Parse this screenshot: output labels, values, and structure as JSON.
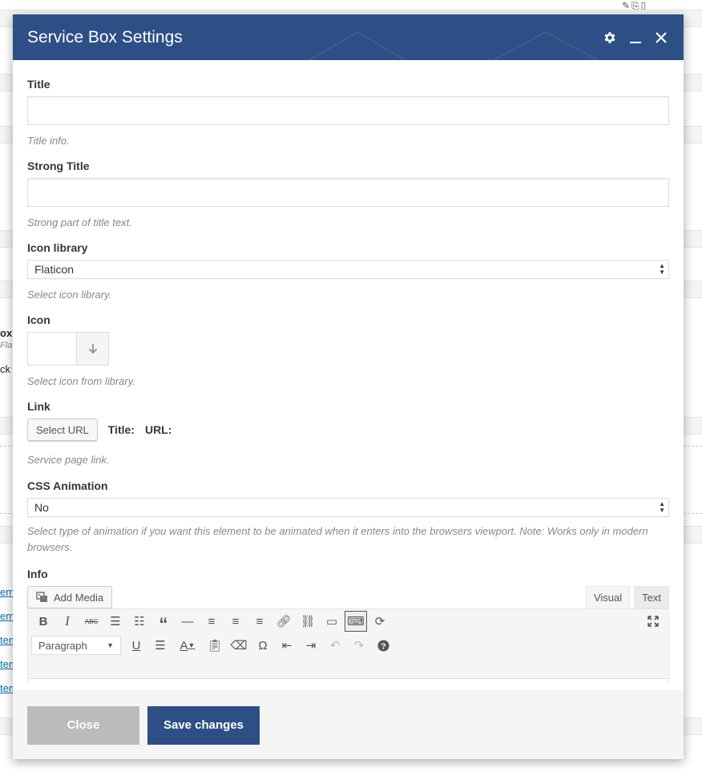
{
  "modal": {
    "title": "Service Box Settings",
    "header_icons": [
      "gear-icon",
      "minimize-icon",
      "close-icon"
    ],
    "accent_color": "#2d4f86"
  },
  "fields": {
    "title": {
      "label": "Title",
      "value": "",
      "help": "Title info."
    },
    "strong_title": {
      "label": "Strong Title",
      "value": "",
      "help": "Strong part of title text."
    },
    "icon_library": {
      "label": "Icon library",
      "selected": "Flaticon",
      "help": "Select icon library."
    },
    "icon": {
      "label": "Icon",
      "help": "Select icon from library."
    },
    "link": {
      "label": "Link",
      "button": "Select URL",
      "title_label": "Title:",
      "url_label": "URL:",
      "help": "Service page link."
    },
    "css_animation": {
      "label": "CSS Animation",
      "selected": "No",
      "help": "Select type of animation if you want this element to be animated when it enters into the browsers viewport. Note: Works only in modern browsers."
    },
    "info": {
      "label": "Info",
      "add_media": "Add Media",
      "tabs": {
        "visual": "Visual",
        "text": "Text"
      },
      "format_select": "Paragraph"
    }
  },
  "footer": {
    "close": "Close",
    "save": "Save changes"
  },
  "background": {
    "fragments": [
      "ox",
      "Fla",
      "ck",
      "emb",
      "emb",
      "tem",
      "tem",
      "tem"
    ]
  }
}
